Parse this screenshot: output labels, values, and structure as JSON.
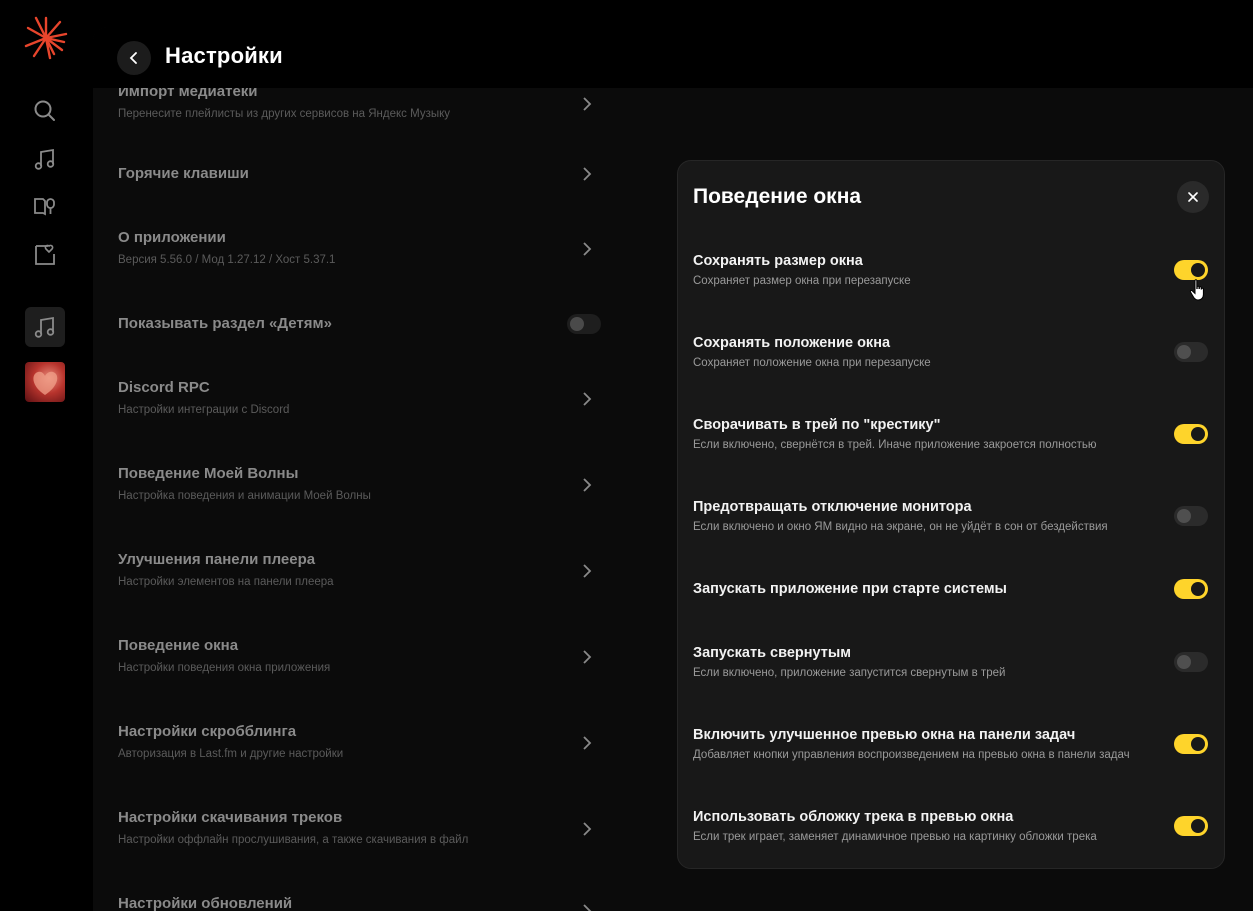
{
  "header": {
    "title": "Настройки"
  },
  "settings": [
    {
      "title": "Импорт медиатеки",
      "subtitle": "Перенесите плейлисты из других сервисов на Яндекс Музыку",
      "control": "chevron"
    },
    {
      "title": "Горячие клавиши",
      "subtitle": "",
      "control": "chevron"
    },
    {
      "title": "О приложении",
      "subtitle": "Версия 5.56.0 / Мод 1.27.12 / Хост 5.37.1",
      "control": "chevron"
    },
    {
      "title": "Показывать раздел «Детям»",
      "subtitle": "",
      "control": "toggle-off"
    },
    {
      "title": "Discord RPC",
      "subtitle": "Настройки интеграции с Discord",
      "control": "chevron"
    },
    {
      "title": "Поведение Моей Волны",
      "subtitle": "Настройка поведения и анимации Моей Волны",
      "control": "chevron"
    },
    {
      "title": "Улучшения панели плеера",
      "subtitle": "Настройки элементов на панели плеера",
      "control": "chevron"
    },
    {
      "title": "Поведение окна",
      "subtitle": "Настройки поведения окна приложения",
      "control": "chevron"
    },
    {
      "title": "Настройки скробблинга",
      "subtitle": "Авторизация в Last.fm и другие настройки",
      "control": "chevron"
    },
    {
      "title": "Настройки скачивания треков",
      "subtitle": "Настройки оффлайн прослушивания, а также скачивания в файл",
      "control": "chevron"
    },
    {
      "title": "Настройки обновлений",
      "subtitle": "",
      "control": "chevron"
    }
  ],
  "modal": {
    "title": "Поведение окна",
    "options": [
      {
        "title": "Сохранять размер окна",
        "subtitle": "Сохраняет размер окна при перезапуске",
        "enabled": true
      },
      {
        "title": "Сохранять положение окна",
        "subtitle": "Сохраняет положение окна при перезапуске",
        "enabled": false
      },
      {
        "title": "Сворачивать в трей по \"крестику\"",
        "subtitle": "Если включено, свернётся в трей. Иначе приложение закроется полностью",
        "enabled": true
      },
      {
        "title": "Предотвращать отключение монитора",
        "subtitle": "Если включено и окно ЯМ видно на экране, он не уйдёт в сон от бездействия",
        "enabled": false
      },
      {
        "title": "Запускать приложение при старте системы",
        "subtitle": "",
        "enabled": true
      },
      {
        "title": "Запускать свернутым",
        "subtitle": "Если включено, приложение запустится свернутым в трей",
        "enabled": false
      },
      {
        "title": "Включить улучшенное превью окна на панели задач",
        "subtitle": "Добавляет кнопки управления воспроизведением на превью окна в панели задач",
        "enabled": true
      },
      {
        "title": "Использовать обложку трека в превью окна",
        "subtitle": "Если трек играет, заменяет динамичное превью на картинку обложки трека",
        "enabled": true
      }
    ]
  },
  "colors": {
    "accent": "#fed42b",
    "logo": "#e8452c"
  }
}
